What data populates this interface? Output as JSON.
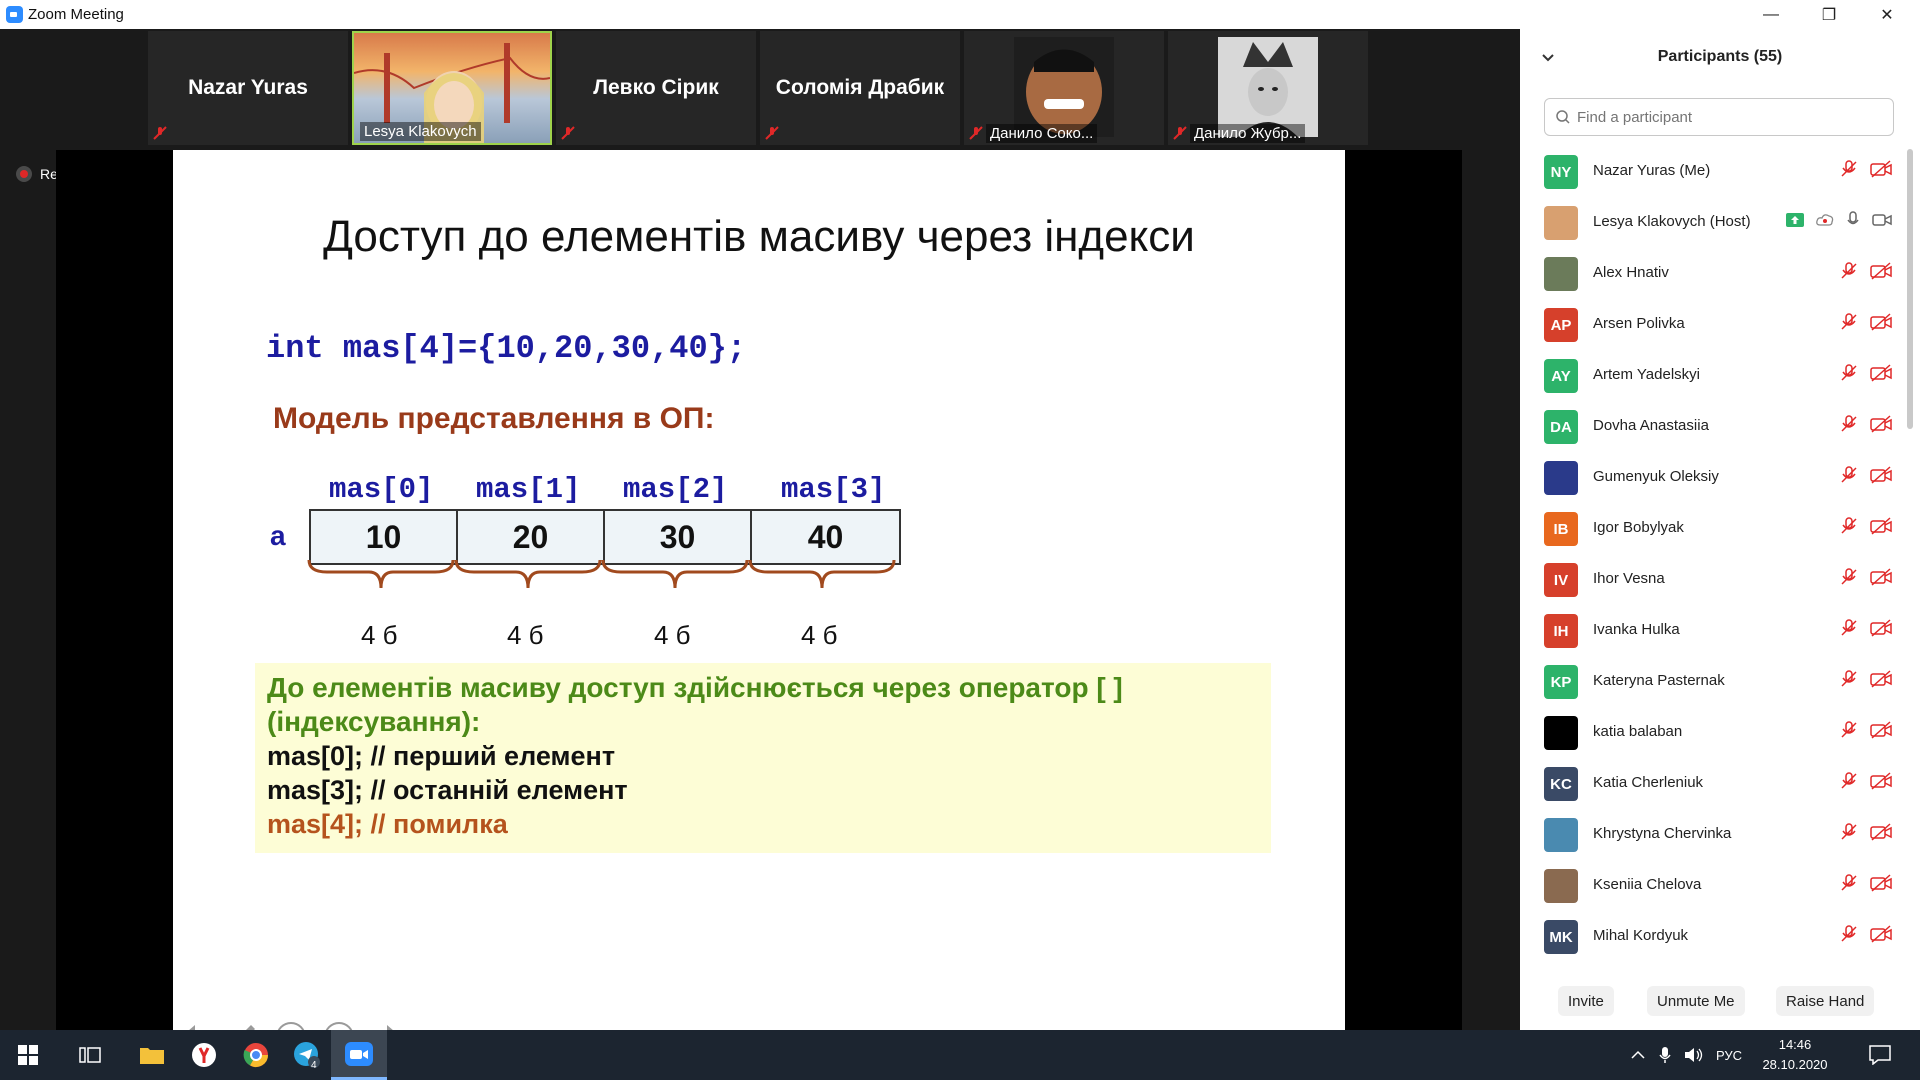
{
  "window": {
    "title": "Zoom Meeting"
  },
  "gallery": {
    "tiles": [
      {
        "name": "Nazar Yuras"
      },
      {
        "name": "Lesya Klakovych"
      },
      {
        "name": "Левко Сірик"
      },
      {
        "name": "Соломія Драбик"
      },
      {
        "name": "Данило Соко..."
      },
      {
        "name": "Данило Жубр..."
      }
    ]
  },
  "recording": {
    "label": "Recording"
  },
  "slide": {
    "title": "Доступ до елементів масиву через індекси",
    "code": "int mas[4]={10,20,30,40};",
    "model_title": "Модель представлення в ОП:",
    "var_name": "a",
    "indices": [
      "mas[0]",
      "mas[1]",
      "mas[2]",
      "mas[3]"
    ],
    "values": [
      "10",
      "20",
      "30",
      "40"
    ],
    "bytes": [
      "4 б",
      "4 б",
      "4 б",
      "4 б"
    ],
    "note": {
      "line1": "До елементів масиву доступ здійснюється через оператор [ ]",
      "line2": "(індексування):",
      "line3": "mas[0]; // перший елемент",
      "line4": "mas[3]; // останній елемент",
      "line5": "mas[4]; // помилка"
    }
  },
  "participants": {
    "title": "Participants (55)",
    "search_placeholder": "Find a participant",
    "list": [
      {
        "initials": "NY",
        "name": "Nazar Yuras (Me)",
        "color": "#2db36a"
      },
      {
        "initials": "",
        "name": "Lesya Klakovych (Host)",
        "color": "#d8a070"
      },
      {
        "initials": "",
        "name": "Alex Hnativ",
        "color": "#6b7b5a"
      },
      {
        "initials": "AP",
        "name": "Arsen Polivka",
        "color": "#d6402b"
      },
      {
        "initials": "AY",
        "name": "Artem Yadelskyi",
        "color": "#2db36a"
      },
      {
        "initials": "DA",
        "name": "Dovha Anastasiia",
        "color": "#2db36a"
      },
      {
        "initials": "",
        "name": "Gumenyuk Oleksiy",
        "color": "#2a3a8a"
      },
      {
        "initials": "IB",
        "name": "Igor Bobylyak",
        "color": "#e8681e"
      },
      {
        "initials": "IV",
        "name": "Ihor Vesna",
        "color": "#d6402b"
      },
      {
        "initials": "IH",
        "name": "Ivanka Hulka",
        "color": "#d6402b"
      },
      {
        "initials": "KP",
        "name": "Kateryna Pasternak",
        "color": "#2db36a"
      },
      {
        "initials": "",
        "name": "katia balaban",
        "color": "#000000"
      },
      {
        "initials": "KC",
        "name": "Katia Cherleniuk",
        "color": "#3a4a66"
      },
      {
        "initials": "",
        "name": "Khrystyna Chervinka",
        "color": "#4a8ab0"
      },
      {
        "initials": "",
        "name": "Kseniia Chelova",
        "color": "#8a6a50"
      },
      {
        "initials": "MK",
        "name": "Mihal Kordyuk",
        "color": "#3a4a66"
      }
    ],
    "buttons": {
      "invite": "Invite",
      "unmute": "Unmute Me",
      "raise": "Raise Hand"
    }
  },
  "taskbar": {
    "lang": "РУС",
    "time": "14:46",
    "date": "28.10.2020",
    "telegram_badge": "4"
  }
}
